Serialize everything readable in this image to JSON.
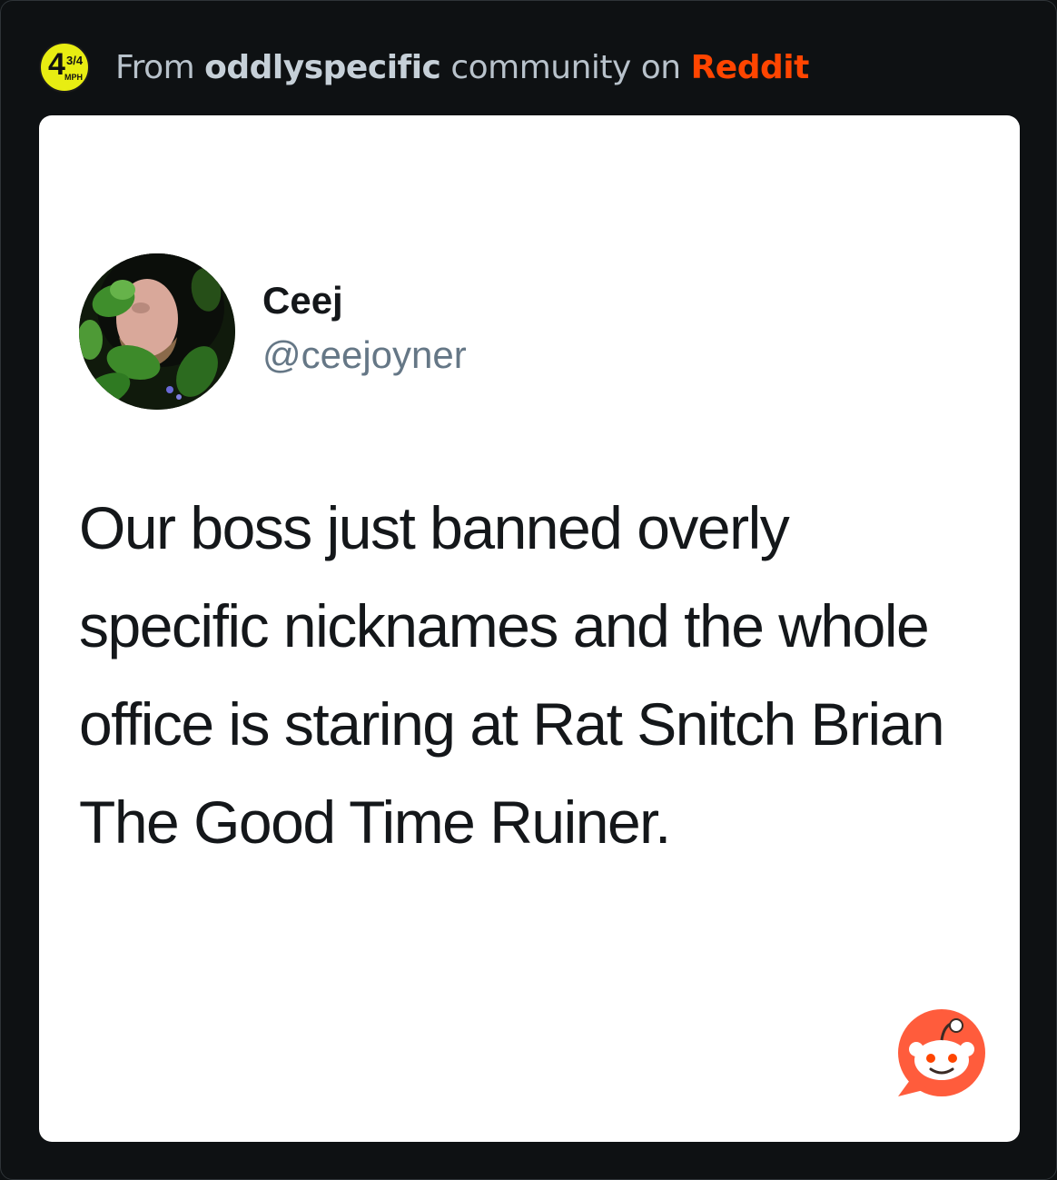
{
  "header": {
    "subreddit_icon": {
      "big": "4",
      "fraction": "3/4",
      "unit": "MPH",
      "color": "#e8ed12"
    },
    "prefix": "From",
    "community": "oddlyspecific",
    "middle": "community on",
    "platform": "Reddit",
    "platform_color": "#ff4500"
  },
  "post": {
    "user": {
      "display_name": "Ceej",
      "handle": "@ceejoyner",
      "avatar_icon": "profile-photo"
    },
    "text": "Our boss just banned overly specific nicknames and the whole office is staring at Rat Snitch Brian The Good Time Ruiner."
  },
  "badge": {
    "icon": "reddit-snoo-icon",
    "color": "#ff5c3c"
  }
}
